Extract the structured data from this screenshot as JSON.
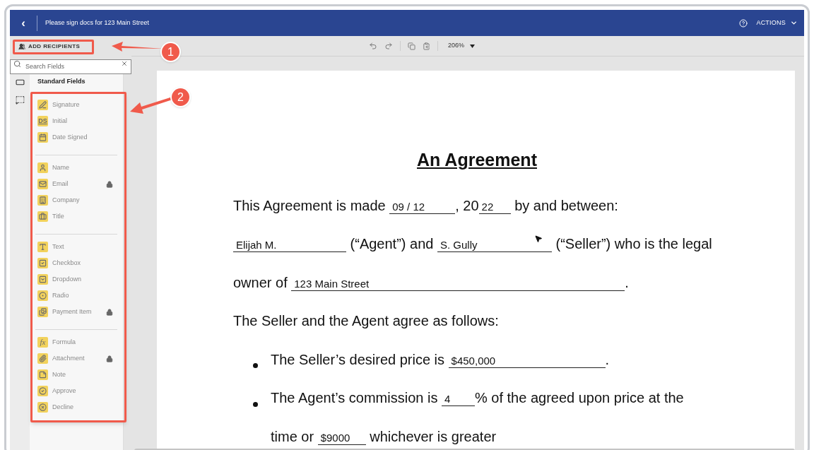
{
  "header": {
    "back": "‹",
    "title": "Please sign docs for 123 Main Street",
    "actions": "ACTIONS"
  },
  "toolbar": {
    "add_recipients": "ADD RECIPIENTS",
    "zoom": "206%"
  },
  "search": {
    "placeholder": "Search Fields"
  },
  "section_title": "Standard Fields",
  "field_groups": [
    [
      {
        "kind": "signature",
        "label": "Signature",
        "locked": false
      },
      {
        "kind": "initial",
        "glyph": "DS",
        "label": "Initial",
        "locked": false
      },
      {
        "kind": "date",
        "label": "Date Signed",
        "locked": false
      }
    ],
    [
      {
        "kind": "name",
        "label": "Name",
        "locked": false
      },
      {
        "kind": "email",
        "label": "Email",
        "locked": true
      },
      {
        "kind": "company",
        "label": "Company",
        "locked": false
      },
      {
        "kind": "title",
        "label": "Title",
        "locked": false
      }
    ],
    [
      {
        "kind": "text",
        "label": "Text",
        "locked": false
      },
      {
        "kind": "checkbox",
        "label": "Checkbox",
        "locked": false
      },
      {
        "kind": "dropdown",
        "label": "Dropdown",
        "locked": false
      },
      {
        "kind": "radio",
        "label": "Radio",
        "locked": false
      },
      {
        "kind": "payment",
        "label": "Payment Item",
        "locked": true
      }
    ],
    [
      {
        "kind": "formula",
        "glyph": "fx",
        "label": "Formula",
        "locked": false
      },
      {
        "kind": "attachment",
        "label": "Attachment",
        "locked": true
      },
      {
        "kind": "note",
        "label": "Note",
        "locked": false
      },
      {
        "kind": "approve",
        "label": "Approve",
        "locked": false
      },
      {
        "kind": "decline",
        "label": "Decline",
        "locked": false
      }
    ]
  ],
  "document": {
    "title": "An Agreement",
    "lines": [
      {
        "kind": "plain",
        "segments": [
          {
            "kind": "text",
            "text": "This Agreement is made "
          },
          {
            "kind": "blank",
            "value": "09 / 12"
          },
          {
            "kind": "text",
            "text": ", 20"
          },
          {
            "kind": "blank",
            "value": "22"
          },
          {
            "kind": "text",
            "text": " by and between:"
          }
        ]
      },
      {
        "kind": "plain",
        "segments": [
          {
            "kind": "blank",
            "value": "Elijah M."
          },
          {
            "kind": "text",
            "text": " (“Agent”) and "
          },
          {
            "kind": "blank",
            "value": "S. Gully"
          },
          {
            "kind": "text",
            "text": " (“Seller”) who is the legal"
          }
        ]
      },
      {
        "kind": "plain",
        "segments": [
          {
            "kind": "text",
            "text": "owner of "
          },
          {
            "kind": "blank",
            "value": "123 Main Street"
          },
          {
            "kind": "text",
            "text": "."
          }
        ]
      },
      {
        "kind": "plain",
        "segments": [
          {
            "kind": "text",
            "text": "The Seller and the Agent agree as follows:"
          }
        ]
      },
      {
        "kind": "bullet",
        "segments": [
          {
            "kind": "text",
            "text": "The Seller’s desired price is "
          },
          {
            "kind": "blank",
            "value": "$450,000"
          },
          {
            "kind": "text",
            "text": "."
          }
        ]
      },
      {
        "kind": "bullet",
        "segments": [
          {
            "kind": "text",
            "text": "The Agent’s commission is "
          },
          {
            "kind": "blank",
            "value": "4"
          },
          {
            "kind": "text",
            "text": "% of the agreed upon price at the"
          }
        ]
      },
      {
        "kind": "indent",
        "segments": [
          {
            "kind": "text",
            "text": "time or "
          },
          {
            "kind": "blank",
            "value": "$9000"
          },
          {
            "kind": "text",
            "text": " whichever is greater"
          }
        ]
      }
    ]
  },
  "callouts": [
    "1",
    "2"
  ]
}
